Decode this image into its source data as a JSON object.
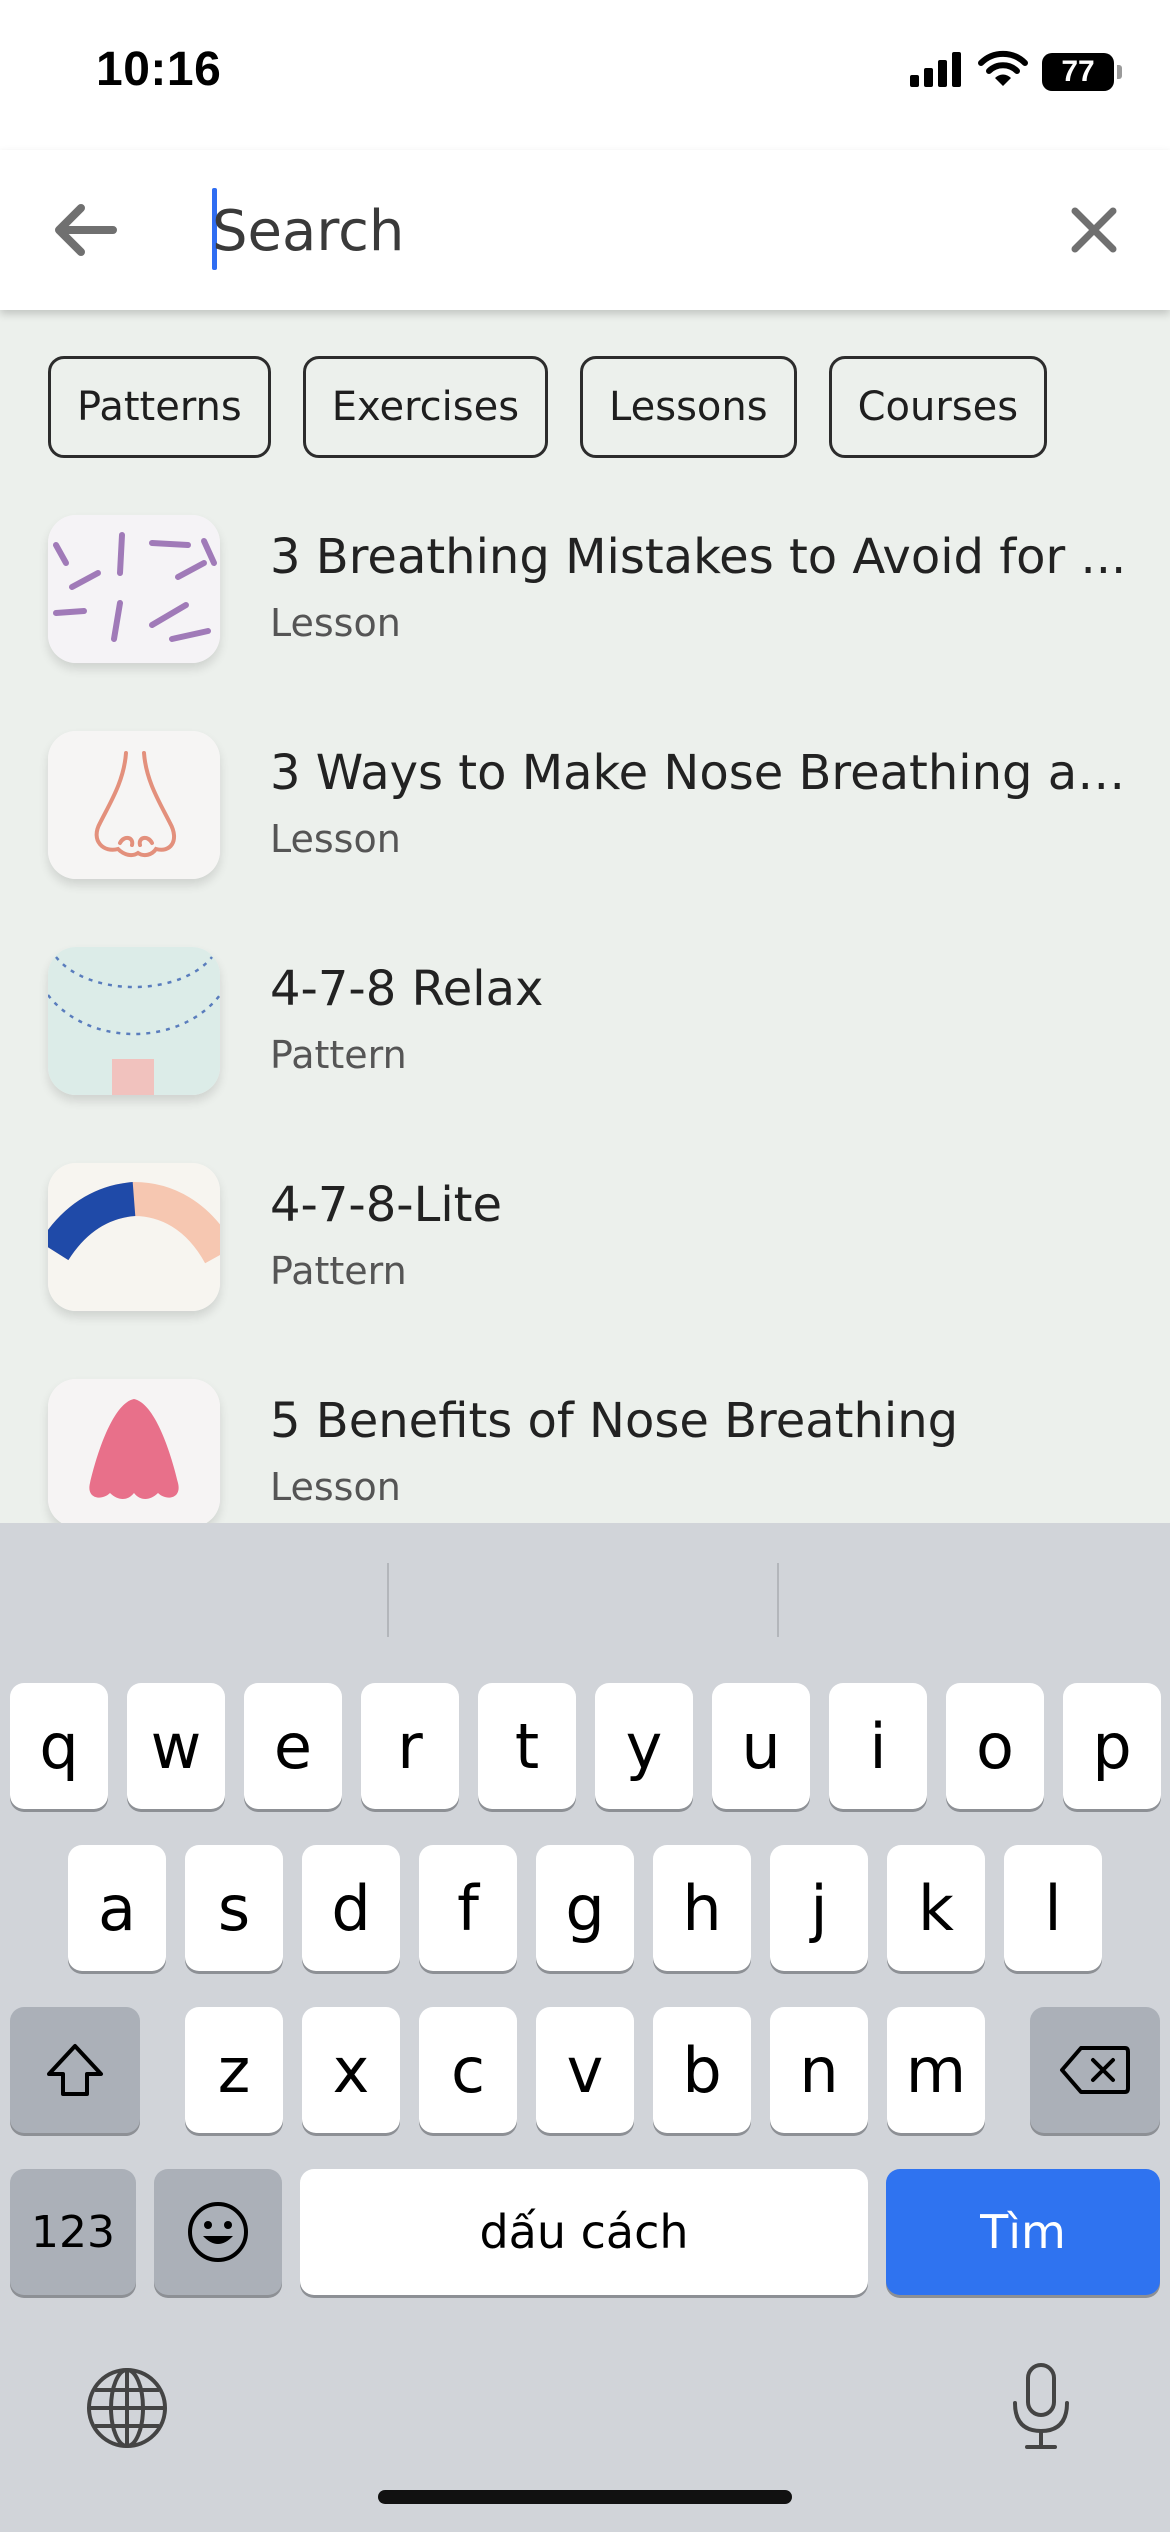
{
  "status": {
    "time": "10:16",
    "battery": "77"
  },
  "search": {
    "placeholder": "Search",
    "value": ""
  },
  "filters": [
    "Patterns",
    "Exercises",
    "Lessons",
    "Courses"
  ],
  "results": [
    {
      "title": "3 Breathing Mistakes to Avoid for ...",
      "type": "Lesson",
      "thumb": "lines-thumb"
    },
    {
      "title": "3 Ways to Make Nose Breathing a ...",
      "type": "Lesson",
      "thumb": "nose-outline-thumb"
    },
    {
      "title": "4-7-8 Relax",
      "type": "Pattern",
      "thumb": "relax-thumb"
    },
    {
      "title": "4-7-8-Lite",
      "type": "Pattern",
      "thumb": "arc-thumb"
    },
    {
      "title": "5 Benefits of Nose Breathing",
      "type": "Lesson",
      "thumb": "nose-pink-thumb"
    }
  ],
  "keyboard": {
    "row1": [
      "q",
      "w",
      "e",
      "r",
      "t",
      "y",
      "u",
      "i",
      "o",
      "p"
    ],
    "row2": [
      "a",
      "s",
      "d",
      "f",
      "g",
      "h",
      "j",
      "k",
      "l"
    ],
    "row3": [
      "z",
      "x",
      "c",
      "v",
      "b",
      "n",
      "m"
    ],
    "numbers_label": "123",
    "space_label": "dấu cách",
    "go_label": "Tìm"
  },
  "colors": {
    "accent": "#2f73f0",
    "content_bg": "#ecf0ec",
    "keyboard_bg": "#d1d4d9"
  }
}
